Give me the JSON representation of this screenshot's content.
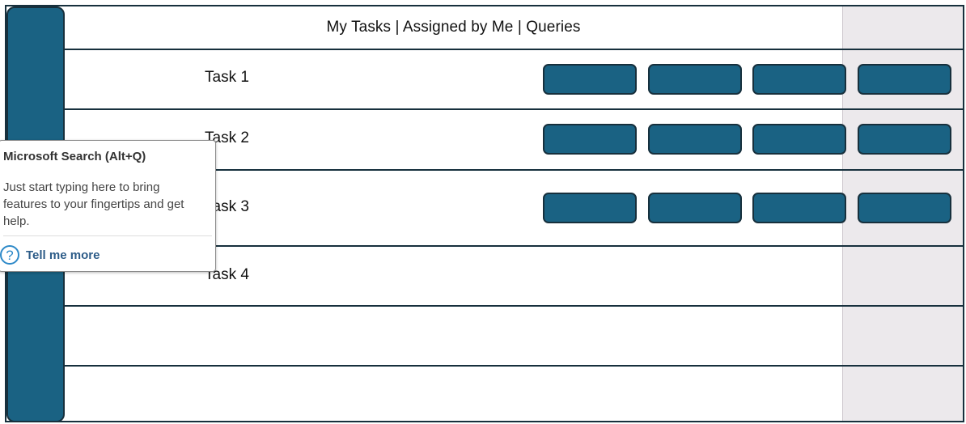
{
  "header": {
    "title": "My Tasks | Assigned by Me | Queries"
  },
  "tasks": [
    {
      "label": "Task 1"
    },
    {
      "label": "Task 2"
    },
    {
      "label": "Task 3"
    },
    {
      "label": "Task 4"
    }
  ],
  "tooltip": {
    "title": "Microsoft Search (Alt+Q)",
    "body": "Just start typing here to bring features to your fingertips and get help.",
    "link": "Tell me more",
    "icon": "help-icon",
    "icon_glyph": "?"
  },
  "colors": {
    "primary": "#1a6283",
    "border": "#17303d",
    "panel": "#ece9ec"
  }
}
